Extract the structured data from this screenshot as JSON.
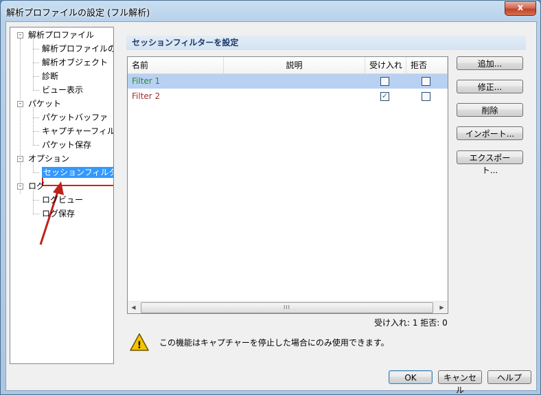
{
  "window": {
    "title": "解析プロファイルの設定 (フル解析)",
    "close_glyph": "x"
  },
  "tree": [
    {
      "label": "解析プロファイル",
      "expander": "-",
      "children": [
        "解析プロファイルの",
        "解析オブジェクト",
        "診断",
        "ビュー表示"
      ]
    },
    {
      "label": "パケット",
      "expander": "-",
      "children": [
        "パケットバッファ",
        "キャプチャーフィル",
        "パケット保存"
      ]
    },
    {
      "label": "オプション",
      "expander": "-",
      "children": [
        "セッションフィルタ"
      ]
    },
    {
      "label": "ログ",
      "expander": "-",
      "children": [
        "ログビュー",
        "ログ保存"
      ]
    }
  ],
  "selected_tree_item": "セッションフィルタ",
  "section_title": "セッションフィルターを設定",
  "list": {
    "columns": [
      "名前",
      "説明",
      "受け入れ",
      "拒否"
    ],
    "rows": [
      {
        "name": "Filter 1",
        "name_color": "#2e8b2e",
        "accept": false,
        "reject": false,
        "selected": true
      },
      {
        "name": "Filter 2",
        "name_color": "#a03030",
        "accept": true,
        "reject": false,
        "selected": false
      }
    ],
    "check_glyph": "✓",
    "scroll_grip": "III"
  },
  "buttons": {
    "add": "追加...",
    "edit": "修正...",
    "delete": "削除",
    "import": "インポート...",
    "export": "エクスポート..."
  },
  "counts_text": "受け入れ: 1 拒否: 0",
  "warning": {
    "icon_glyph": "!",
    "text": "この機能はキャプチャーを停止した場合にのみ使用できます。"
  },
  "footer": {
    "ok": "OK",
    "cancel": "キャンセル",
    "help": "ヘルプ"
  }
}
